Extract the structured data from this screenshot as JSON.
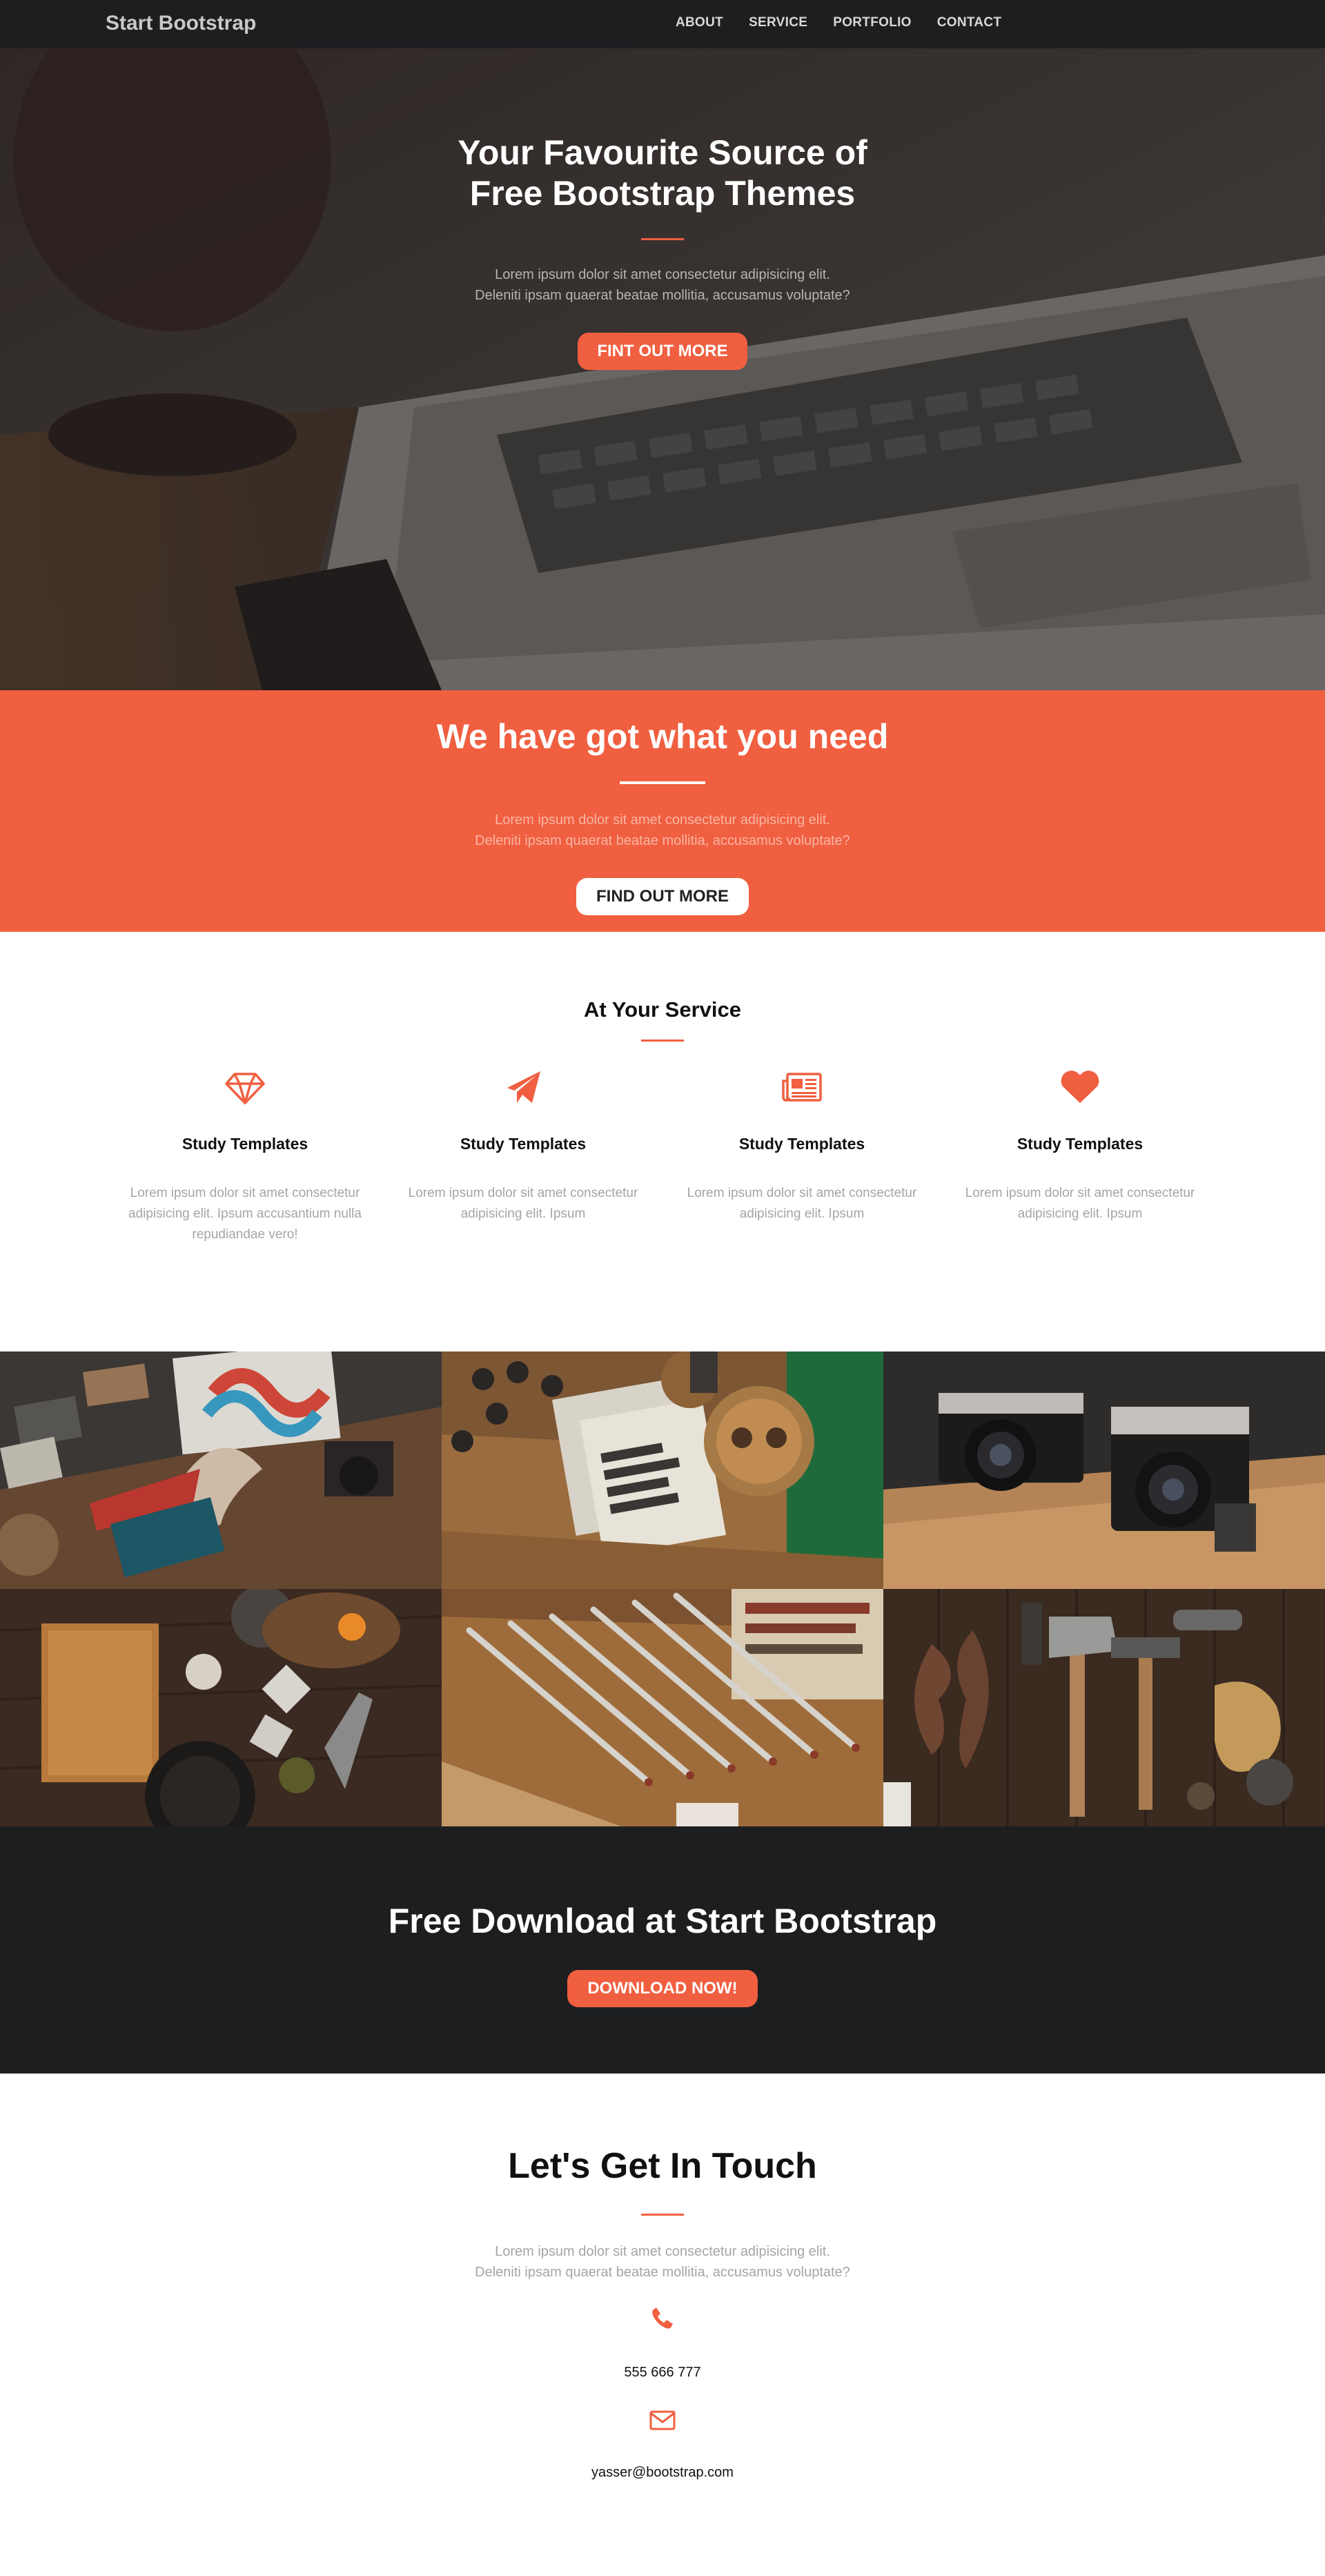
{
  "navbar": {
    "brand": "Start Bootstrap",
    "links": [
      "ABOUT",
      "SERVICE",
      "PORTFOLIO",
      "CONTACT"
    ]
  },
  "hero": {
    "title_line1": "Your Favourite Source of",
    "title_line2": "Free Bootstrap Themes",
    "text_line1": "Lorem ipsum dolor sit amet consectetur adipisicing elit.",
    "text_line2": "Deleniti ipsam quaerat beatae mollitia, accusamus voluptate?",
    "button": "FINT OUT MORE"
  },
  "band": {
    "title": "We have got what you need",
    "text_line1": "Lorem ipsum dolor sit amet consectetur adipisicing elit.",
    "text_line2": "Deleniti ipsam quaerat beatae mollitia, accusamus voluptate?",
    "button": "FIND OUT MORE"
  },
  "services": {
    "title": "At Your Service",
    "items": [
      {
        "icon": "diamond-icon",
        "heading": "Study Templates",
        "text": "Lorem ipsum dolor sit amet consectetur adipisicing elit. Ipsum accusantium nulla repudiandae vero!"
      },
      {
        "icon": "paper-plane-icon",
        "heading": "Study Templates",
        "text": "Lorem ipsum dolor sit amet consectetur adipisicing elit. Ipsum"
      },
      {
        "icon": "newspaper-icon",
        "heading": "Study Templates",
        "text": "Lorem ipsum dolor sit amet consectetur adipisicing elit. Ipsum"
      },
      {
        "icon": "heart-icon",
        "heading": "Study Templates",
        "text": "Lorem ipsum dolor sit amet consectetur adipisicing elit. Ipsum"
      }
    ]
  },
  "portfolio": {
    "tiles": [
      "portfolio-image",
      "portfolio-image",
      "portfolio-image",
      "portfolio-image",
      "portfolio-image",
      "portfolio-image"
    ]
  },
  "download": {
    "title": "Free Download at Start Bootstrap",
    "button": "DOWNLOAD NOW!"
  },
  "contact": {
    "title": "Let's Get In Touch",
    "text_line1": "Lorem ipsum dolor sit amet consectetur adipisicing elit.",
    "text_line2": "Deleniti ipsam quaerat beatae mollitia, accusamus voluptate?",
    "phone": "555 666 777",
    "email": "yasser@bootstrap.com"
  },
  "colors": {
    "accent": "#f05f40",
    "dark": "#1d1e20"
  }
}
